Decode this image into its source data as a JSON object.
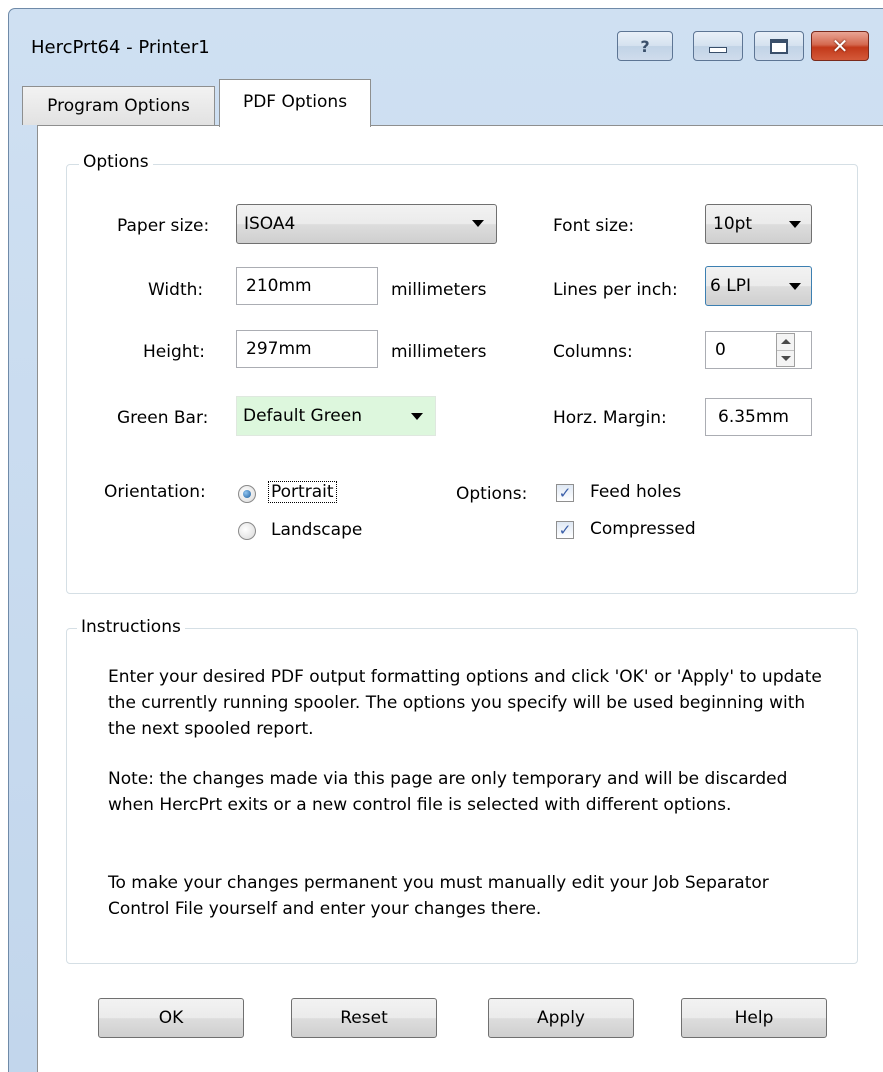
{
  "window": {
    "title": "HercPrt64  -  Printer1",
    "help_glyph": "?",
    "close_glyph": "✕"
  },
  "tabs": [
    {
      "label": "Program Options",
      "active": false
    },
    {
      "label": "PDF Options",
      "active": true
    }
  ],
  "options": {
    "group_title": "Options",
    "paper_size": {
      "label": "Paper size:",
      "value": "ISOA4"
    },
    "width": {
      "label": "Width:",
      "value": "210mm",
      "unit": "millimeters"
    },
    "height": {
      "label": "Height:",
      "value": "297mm",
      "unit": "millimeters"
    },
    "green_bar": {
      "label": "Green Bar:",
      "value": "Default Green",
      "color": "#ddf7dd"
    },
    "orientation": {
      "label": "Orientation:",
      "portrait": {
        "label": "Portrait",
        "selected": true
      },
      "landscape": {
        "label": "Landscape",
        "selected": false
      }
    },
    "font_size": {
      "label": "Font size:",
      "value": "10pt"
    },
    "lines_per_inch": {
      "label": "Lines per inch:",
      "value": "6 LPI"
    },
    "columns": {
      "label": "Columns:",
      "value": "0"
    },
    "horz_margin": {
      "label": "Horz. Margin:",
      "value": "6.35mm"
    },
    "flags": {
      "label": "Options:",
      "feed_holes": {
        "label": "Feed holes",
        "checked": true
      },
      "compressed": {
        "label": "Compressed",
        "checked": true
      }
    }
  },
  "instructions": {
    "group_title": "Instructions",
    "paragraphs": [
      "Enter your desired PDF output formatting options and click 'OK' or 'Apply' to update the currently running spooler. The options you specify will be used beginning with the next spooled report.",
      "Note: the changes made via this page are only temporary and will be discarded when HercPrt exits or a new control file is selected with different options.",
      "To make your changes permanent you must manually edit your Job Separator Control File yourself and enter your changes there."
    ]
  },
  "buttons": {
    "ok": "OK",
    "reset": "Reset",
    "apply": "Apply",
    "help": "Help"
  }
}
